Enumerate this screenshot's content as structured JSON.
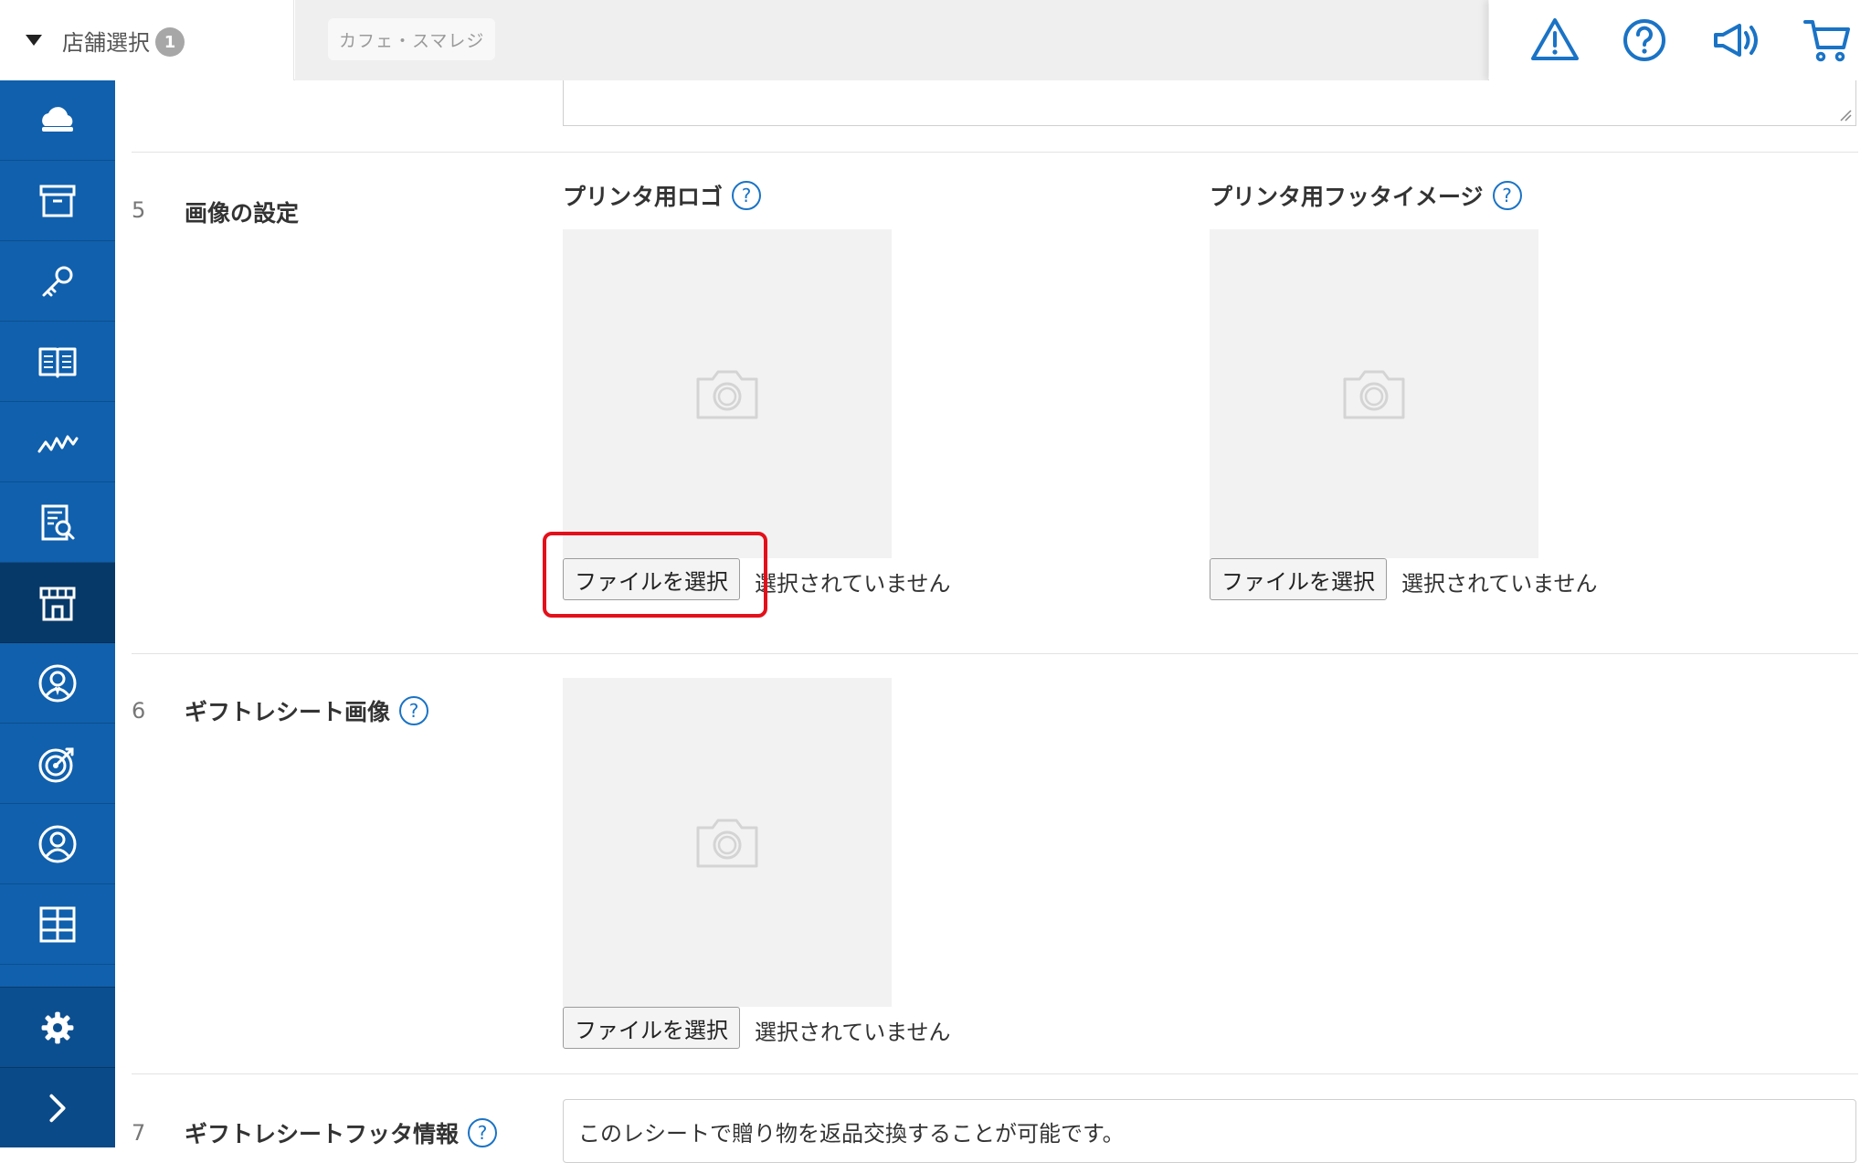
{
  "header": {
    "store_select_label": "店舗選択",
    "store_count": "1",
    "current_store": "カフェ・スマレジ",
    "icons": [
      "warning-icon",
      "help-circle-icon",
      "megaphone-icon",
      "cart-icon"
    ]
  },
  "sidebar": {
    "items": [
      {
        "icon": "cloud-icon",
        "active": false
      },
      {
        "icon": "archive-box-icon",
        "active": false
      },
      {
        "icon": "key-icon",
        "active": false
      },
      {
        "icon": "book-icon",
        "active": false
      },
      {
        "icon": "chart-line-icon",
        "active": false
      },
      {
        "icon": "report-search-icon",
        "active": false
      },
      {
        "icon": "store-icon",
        "active": true
      },
      {
        "icon": "staff-icon",
        "active": false
      },
      {
        "icon": "target-icon",
        "active": false
      },
      {
        "icon": "customer-icon",
        "active": false
      },
      {
        "icon": "grid-icon",
        "active": false
      }
    ],
    "bottom": [
      "gear-icon",
      "chevron-right-icon"
    ]
  },
  "sections": {
    "image_settings": {
      "number": "5",
      "title": "画像の設定",
      "printer_logo": {
        "title": "プリンタ用ロゴ",
        "button": "ファイルを選択",
        "status": "選択されていません"
      },
      "printer_footer": {
        "title": "プリンタ用フッタイメージ",
        "button": "ファイルを選択",
        "status": "選択されていません"
      }
    },
    "gift_receipt_image": {
      "number": "6",
      "title": "ギフトレシート画像",
      "button": "ファイルを選択",
      "status": "選択されていません"
    },
    "gift_receipt_footer": {
      "number": "7",
      "title": "ギフトレシートフッタ情報",
      "value": "このレシートで贈り物を返品交換することが可能です。"
    }
  },
  "colors": {
    "sidebar": "#1060ad",
    "sidebar_active": "#073968",
    "accent": "#1a73c5",
    "highlight": "#e3101a"
  }
}
